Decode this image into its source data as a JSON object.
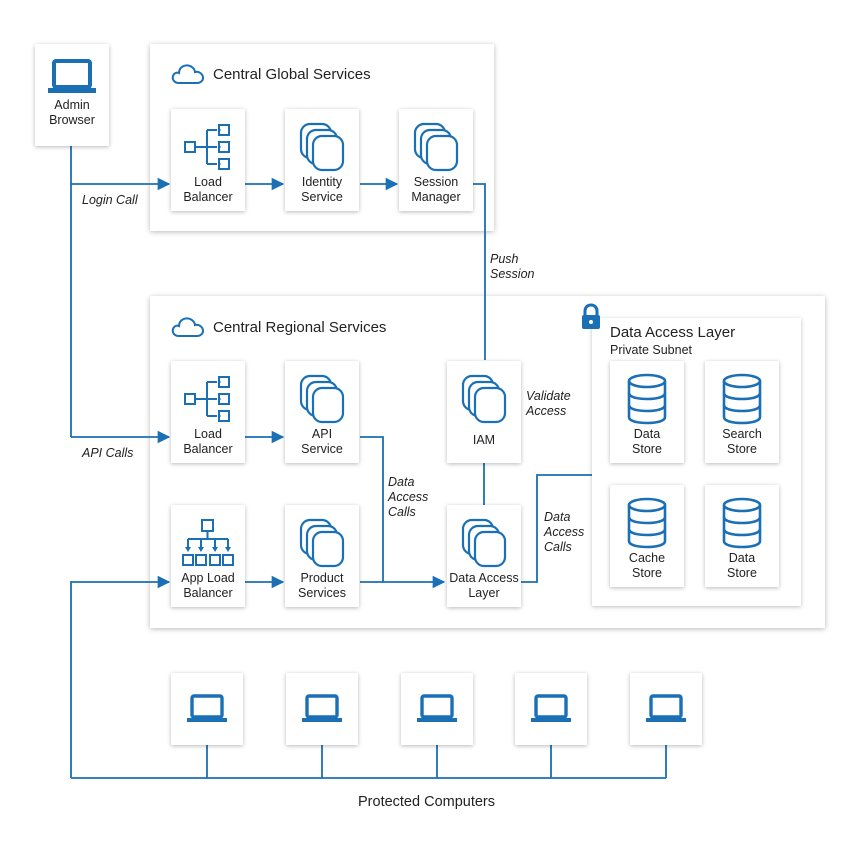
{
  "colors": {
    "accent": "#1a6fb5",
    "line": "#1a6fb5"
  },
  "admin_browser": {
    "label": "Admin\nBrowser",
    "icon": "laptop-icon"
  },
  "global": {
    "title": "Central Global Services",
    "icon": "cloud-icon",
    "load_balancer": "Load\nBalancer",
    "identity_service": "Identity\nService",
    "session_manager": "Session\nManager"
  },
  "regional": {
    "title": "Central Regional Services",
    "icon": "cloud-icon",
    "load_balancer": "Load\nBalancer",
    "api_service": "API\nService",
    "app_load_balancer": "App Load\nBalancer",
    "product_services": "Product\nServices",
    "iam": "IAM",
    "data_access_layer": "Data Access\nLayer"
  },
  "data_layer": {
    "title": "Data Access Layer",
    "subtitle": "Private Subnet",
    "lock_icon": "lock-icon",
    "data_store_1": "Data\nStore",
    "search_store": "Search\nStore",
    "cache_store": "Cache\nStore",
    "data_store_2": "Data\nStore"
  },
  "notes": {
    "login_call": "Login Call",
    "api_calls": "API Calls",
    "push_session": "Push\nSession",
    "validate_access": "Validate\nAccess",
    "data_access_calls_1": "Data\nAccess\nCalls",
    "data_access_calls_2": "Data\nAccess\nCalls"
  },
  "protected": {
    "caption": "Protected Computers",
    "count": 5
  }
}
